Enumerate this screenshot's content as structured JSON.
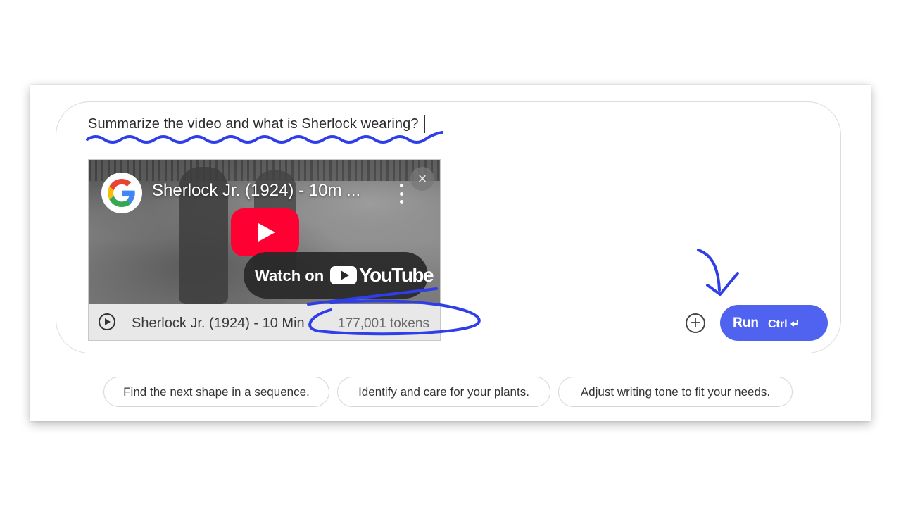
{
  "prompt": {
    "text": "Summarize the video and what is Sherlock wearing?"
  },
  "video": {
    "title": "Sherlock Jr. (1924) - 10m ...",
    "watch_label": "Watch on",
    "youtube_word": "YouTube",
    "footer_title": "Sherlock Jr. (1924) - 10 Min .",
    "tokens": "177,001 tokens"
  },
  "actions": {
    "run_label": "Run",
    "run_shortcut": "Ctrl ↵"
  },
  "suggestions": [
    {
      "label": "Find the next shape in a sequence."
    },
    {
      "label": "Identify and care for your plants."
    },
    {
      "label": "Adjust writing tone to fit your needs."
    }
  ],
  "colors": {
    "accent": "#4f63f0",
    "annotation": "#2f3ee8",
    "youtube_red": "#ff0033"
  }
}
